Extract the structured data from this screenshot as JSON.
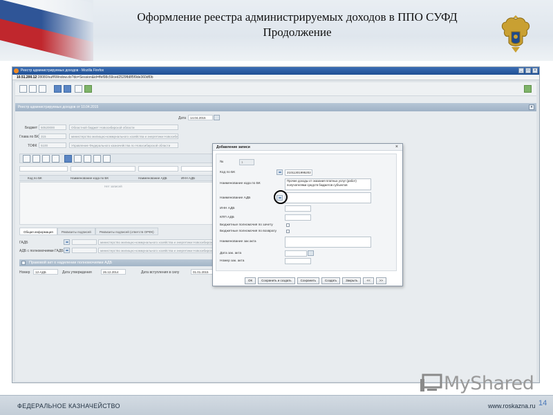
{
  "slide": {
    "title_line1": "Оформление реестра администрируемых доходов в ППО СУФД",
    "title_line2": "Продолжение",
    "page_number": "14",
    "footer_left": "ФЕДЕРАЛЬНОЕ КАЗНАЧЕЙСТВО",
    "footer_right": "www.roskazna.ru",
    "watermark": "MyShared"
  },
  "browser": {
    "window_title": "Реестр администрируемых доходов - Mozilla Firefox",
    "url_host": "10.51.200.12",
    "url_rest": ":28080/suff/Window.do?do=Session&id=ffef98c59ced2529fb8f5f9de360df0b",
    "buttons": [
      "_",
      "□",
      "×"
    ]
  },
  "app": {
    "panel_title": "Реестр администрируемых доходов от 10.04.2015",
    "date_label": "Дата",
    "date_value": "14.04.2015",
    "fields": {
      "budget_label": "Бюджет",
      "budget_code": "50520000",
      "budget_name": "Областной бюджет Новосибирской области",
      "gabs_label": "Глава по БК",
      "gabs_code": "315",
      "gabs_name": "министерство жилищно-коммунального хозяйства и энергетики Новосибирской области",
      "tofk_label": "ТОФК",
      "tofk_code": "5100",
      "tofk_name": "Управление Федерального казначейства по Новосибирской области"
    },
    "grid": {
      "columns": [
        "Код по БК",
        "Наименование кода по БК",
        "Наименование АДБ",
        "ИНН АДБ"
      ],
      "empty_text": "Нет записей"
    },
    "tabs": [
      "Общая информация",
      "Реквизиты подписей",
      "Реквизиты подписей (ответств ОРФК)"
    ],
    "gadb_label": "ГАДБ",
    "gadb_value": "министерство жилищно-коммунального хозяйства и энергетики Новосибирской области",
    "adb_powers_label": "АДБ с полномочиями ГАДБ",
    "adb_powers_value": "министерство жилищно-коммунального хозяйства и энергетики Новосибирской области",
    "legal_act_title": "Правовой акт о наделении полномочиями АДБ",
    "legal_number_label": "Номер",
    "legal_number_value": "12-АДБ",
    "legal_approve_label": "Дата утверждения",
    "legal_approve_value": "26.12.2014",
    "legal_effective_label": "Дата вступления в силу",
    "legal_effective_value": "01.01.2015"
  },
  "dialog": {
    "title": "Добавление записи",
    "close": "×",
    "no_label": "№",
    "no_value": "1",
    "kbk_label": "Код по БК",
    "kbk_value": "21011301995202",
    "kbk_name_label": "Наименование кода по БК",
    "kbk_name_value": "Прочие доходы от оказания платных услуг (работ) получателями средств бюджетов субъектов",
    "adb_name_label": "Наименование АДБ",
    "inn_label": "ИНН АДБ",
    "kpp_label": "КПП АДБ",
    "credit_label": "Бюджетные полномочия по зачету",
    "refund_label": "Бюджетные полномочия по возврату",
    "act_name_label": "Наименование зак акта",
    "act_date_label": "Дата зак. акта",
    "act_number_label": "Номер зак. акта",
    "buttons": [
      "ОК",
      "Сохранить и создать",
      "Сохранить",
      "Создать",
      "Закрыть",
      "<<",
      ">>"
    ]
  },
  "colors": {
    "panel_header": "#9fb2c6",
    "titlebar": "#1f4f93",
    "highlight_circle": "#000000",
    "page_number": "#4a78b8"
  },
  "icons": [
    "firefox-icon",
    "save-icon",
    "print-icon",
    "lookup-icon",
    "calendar-icon",
    "close-icon",
    "emblem-icon",
    "watermark-icon"
  ]
}
